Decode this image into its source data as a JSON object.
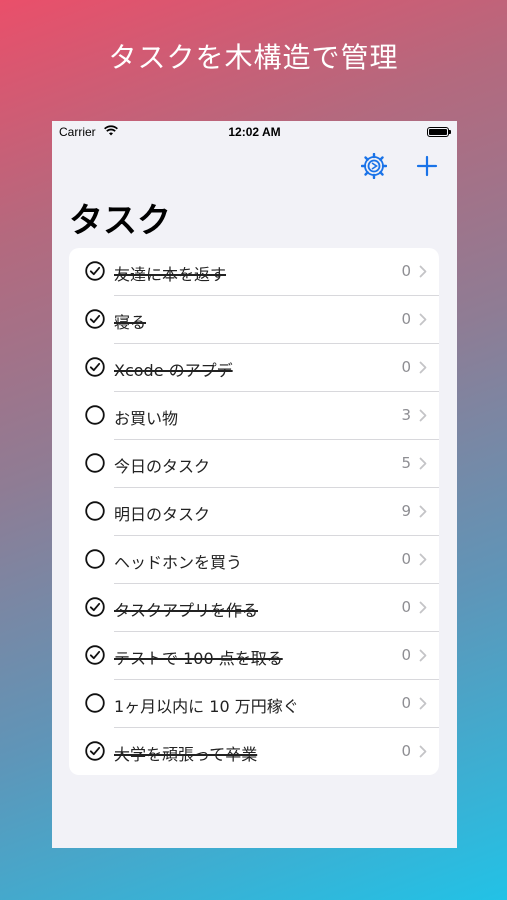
{
  "headline": "タスクを木構造で管理",
  "status_bar": {
    "carrier": "Carrier",
    "time": "12:02 AM"
  },
  "nav": {
    "title": "タスク"
  },
  "colors": {
    "accent": "#1a73e8",
    "secondary": "#8e8e93"
  },
  "icons": {
    "settings": "gear-icon",
    "add": "plus-icon",
    "checked": "checkmark-circle-icon",
    "unchecked": "empty-circle-icon",
    "disclosure": "chevron-right-icon"
  },
  "tasks": [
    {
      "title": "友達に本を返す",
      "count": "0",
      "done": true
    },
    {
      "title": "寝る",
      "count": "0",
      "done": true
    },
    {
      "title": "Xcode のアプデ",
      "count": "0",
      "done": true
    },
    {
      "title": "お買い物",
      "count": "3",
      "done": false
    },
    {
      "title": "今日のタスク",
      "count": "5",
      "done": false
    },
    {
      "title": "明日のタスク",
      "count": "9",
      "done": false
    },
    {
      "title": "ヘッドホンを買う",
      "count": "0",
      "done": false
    },
    {
      "title": "タスクアプリを作る",
      "count": "0",
      "done": true
    },
    {
      "title": "テストで 100 点を取る",
      "count": "0",
      "done": true
    },
    {
      "title": "1ヶ月以内に 10 万円稼ぐ",
      "count": "0",
      "done": false
    },
    {
      "title": "大学を頑張って卒業",
      "count": "0",
      "done": true
    }
  ]
}
